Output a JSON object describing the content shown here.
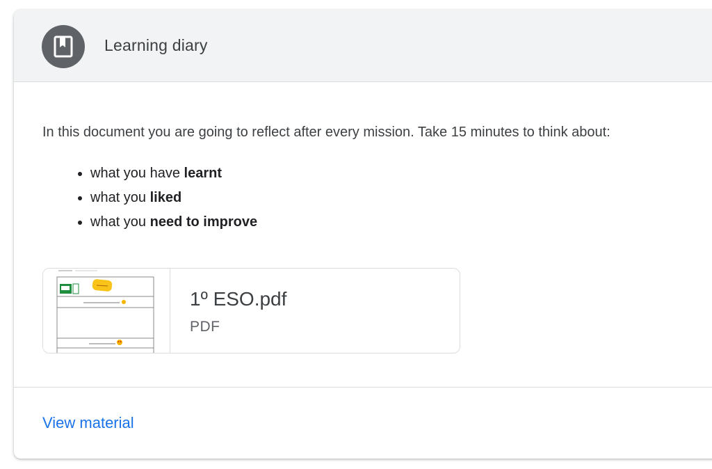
{
  "header": {
    "icon": "bookmark-book-icon",
    "title": "Learning diary"
  },
  "description": "In this document you are going to reflect after every mission. Take 15 minutes to think about:",
  "bullets": [
    {
      "prefix": "what you have ",
      "bold": "learnt"
    },
    {
      "prefix": "what you ",
      "bold": "liked"
    },
    {
      "prefix": "what you ",
      "bold": "need to improve"
    }
  ],
  "attachment": {
    "name": "1º ESO.pdf",
    "type": "PDF",
    "thumbnail": "pdf-preview-thumbnail"
  },
  "footer": {
    "link_label": "View material"
  },
  "colors": {
    "header_bg": "#f1f3f4",
    "avatar_bg": "#5f6368",
    "link": "#1a73e8",
    "border": "#dadce0"
  }
}
